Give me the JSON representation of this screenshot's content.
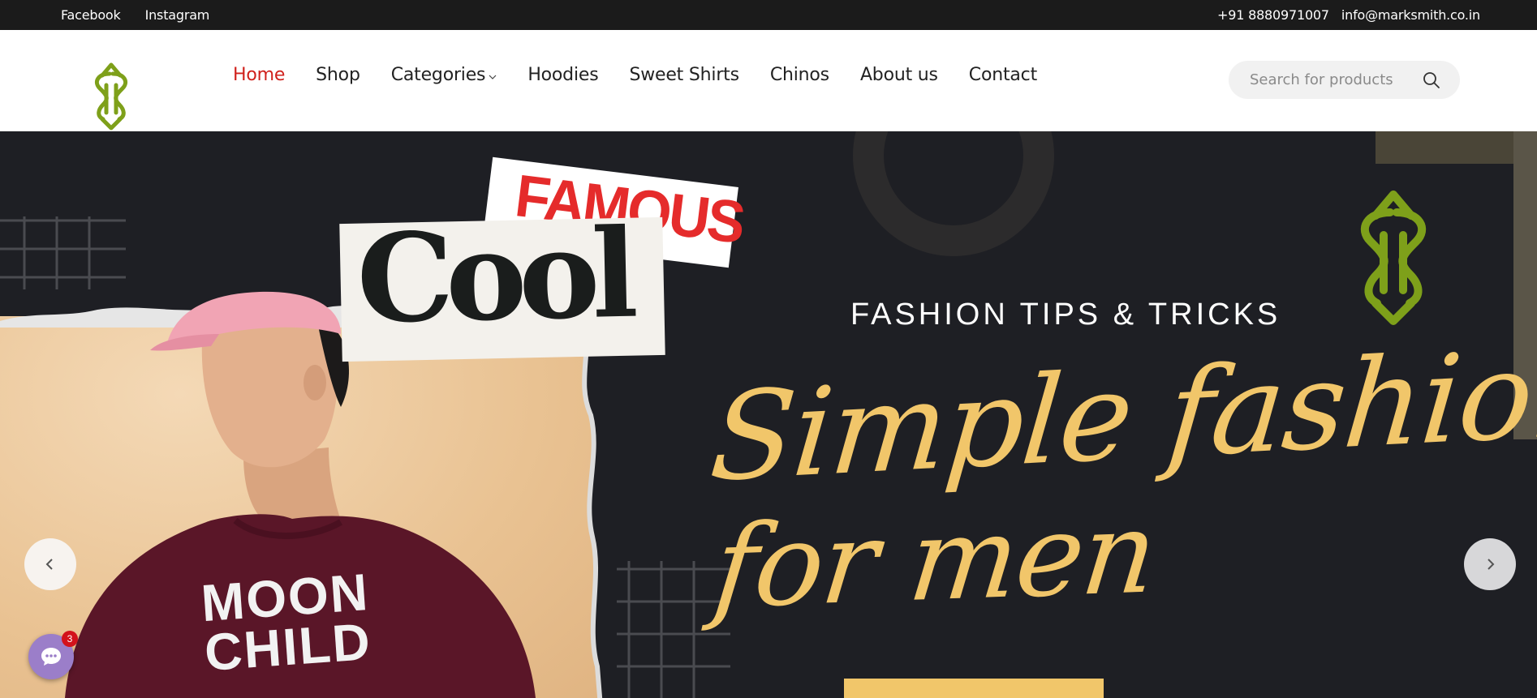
{
  "topbar": {
    "social": [
      "Facebook",
      "Instagram"
    ],
    "phone": "+91 8880971007",
    "email": "info@marksmith.co.in"
  },
  "nav": {
    "items": [
      {
        "label": "Home",
        "active": true
      },
      {
        "label": "Shop"
      },
      {
        "label": "Categories",
        "has_dropdown": true
      },
      {
        "label": "Hoodies"
      },
      {
        "label": "Sweet Shirts"
      },
      {
        "label": "Chinos"
      },
      {
        "label": "About us"
      },
      {
        "label": "Contact"
      }
    ]
  },
  "search": {
    "placeholder": "Search for products"
  },
  "hero": {
    "clip_top": "FAMOUS",
    "clip_main": "Cool",
    "tagline": "FASHION TIPS & TRICKS",
    "headline_line1": "Simple fashion",
    "headline_line2": "for men",
    "shirt_print": [
      "MOON",
      "CHILD"
    ]
  },
  "chat": {
    "badge_count": "3"
  },
  "colors": {
    "accent_red": "#d0211c",
    "logo_green": "#7ea01a",
    "hero_bg": "#1e1f24",
    "script_gold": "#f1c66a",
    "shirt_maroon": "#5a1628"
  },
  "icons": [
    "logo-icon",
    "chevron-down-icon",
    "search-icon",
    "chevron-left-icon",
    "chevron-right-icon",
    "chat-icon"
  ]
}
